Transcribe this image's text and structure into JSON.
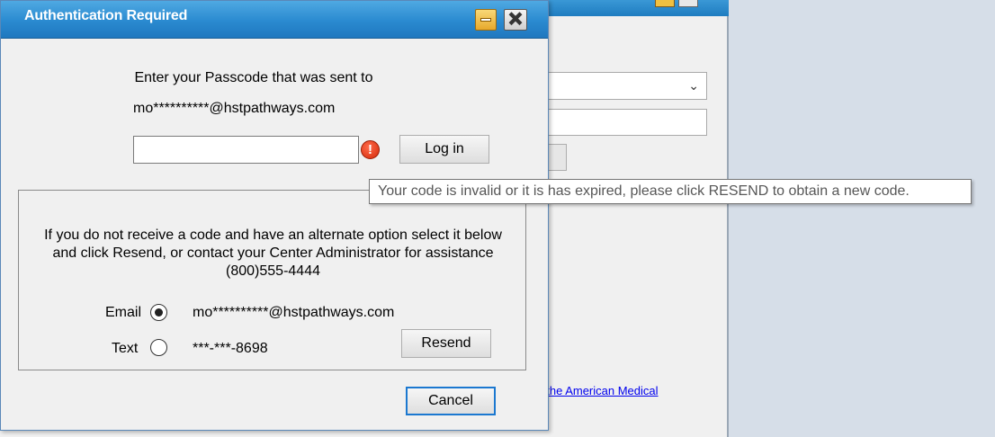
{
  "dialog": {
    "title": "Authentication Required",
    "passcode_prompt": "Enter your Passcode that was sent to",
    "masked_email": "mo**********@hstpathways.com",
    "passcode_value": "",
    "login_label": "Log in",
    "error_icon": "error-exclamation-icon",
    "info_text": "If you do not receive a code and have an alternate option select it below and click Resend, or contact your Center Administrator for assistance (800)555-4444",
    "options": {
      "email_label": "Email",
      "email_value": "mo**********@hstpathways.com",
      "email_selected": true,
      "text_label": "Text",
      "text_value": "***-***-8698",
      "text_selected": false
    },
    "resend_label": "Resend",
    "cancel_label": "Cancel"
  },
  "tooltip": {
    "text": "Your code is invalid or it is has expired, please click RESEND to obtain a new code."
  },
  "background_window": {
    "link_text": "f the American Medical"
  },
  "colors": {
    "titlebar": "#2a8ad0",
    "error": "#d42a0a",
    "focus_border": "#1b78d0",
    "link": "#0000ee"
  }
}
